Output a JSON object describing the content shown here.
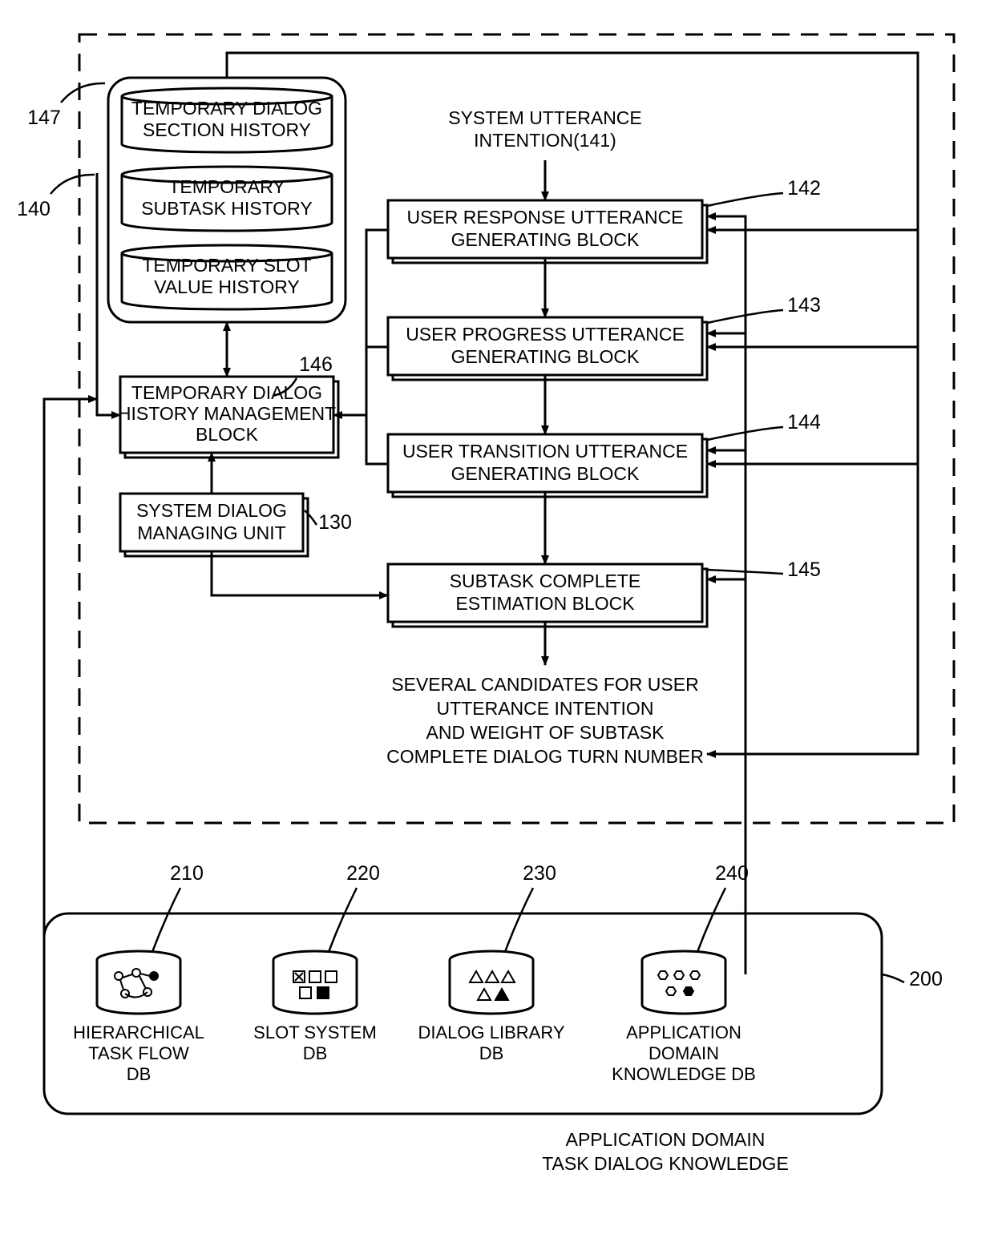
{
  "refs": {
    "r140": "140",
    "r147": "147",
    "r146": "146",
    "r130": "130",
    "r141": "SYSTEM UTTERANCE\nINTENTION(141)",
    "r142": "142",
    "r143": "143",
    "r144": "144",
    "r145": "145",
    "r200": "200",
    "r210": "210",
    "r220": "220",
    "r230": "230",
    "r240": "240"
  },
  "blocks": {
    "tempSection": "TEMPORARY DIALOG\nSECTION HISTORY",
    "tempSubtask": "TEMPORARY\nSUBTASK HISTORY",
    "tempSlot": "TEMPORARY SLOT\nVALUE HISTORY",
    "tempMgmt": "TEMPORARY DIALOG\nHISTORY MANAGEMENT\nBLOCK",
    "sysDialog": "SYSTEM DIALOG\nMANAGING UNIT",
    "userResp": "USER RESPONSE UTTERANCE\nGENERATING BLOCK",
    "userProg": "USER PROGRESS UTTERANCE\nGENERATING BLOCK",
    "userTrans": "USER TRANSITION UTTERANCE\nGENERATING BLOCK",
    "subtaskEst": "SUBTASK COMPLETE\nESTIMATION BLOCK",
    "output": "SEVERAL CANDIDATES FOR USER\nUTTERANCE INTENTION\nAND WEIGHT OF SUBTASK\nCOMPLETE DIALOG TURN NUMBER"
  },
  "dbs": {
    "hier": "HIERARCHICAL\nTASK FLOW\nDB",
    "slot": "SLOT SYSTEM\nDB",
    "dlg": "DIALOG LIBRARY\nDB",
    "app": "APPLICATION\nDOMAIN\nKNOWLEDGE DB",
    "title": "APPLICATION DOMAIN\nTASK DIALOG KNOWLEDGE"
  }
}
